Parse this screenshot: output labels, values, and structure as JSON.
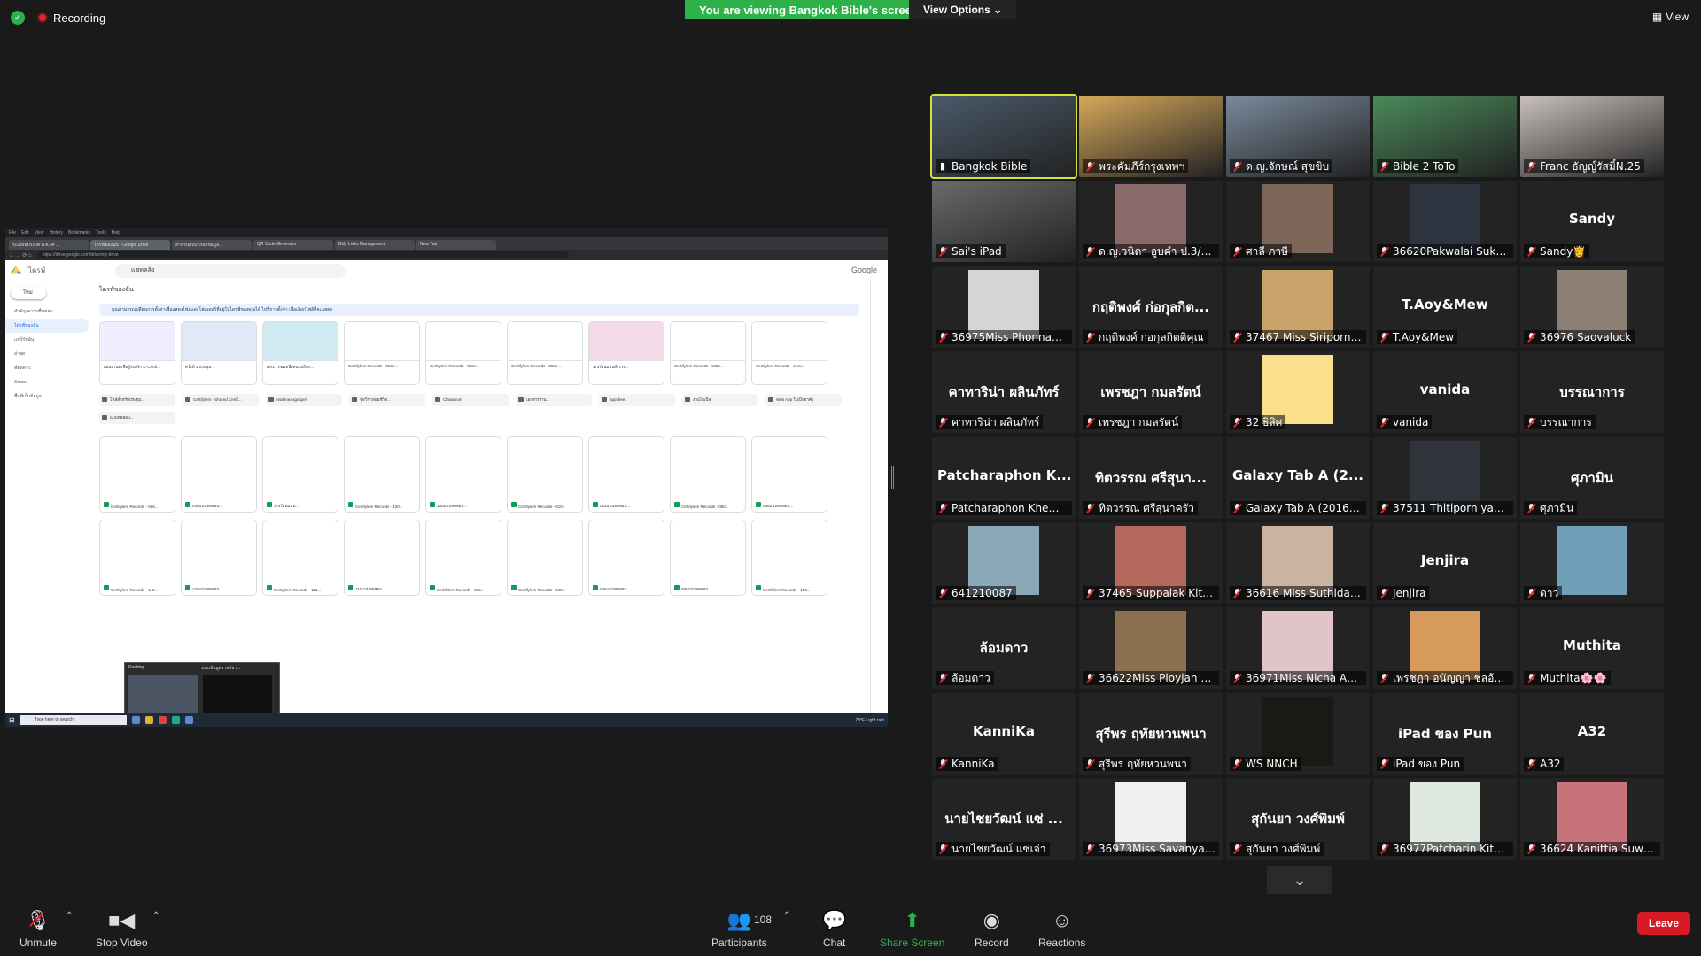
{
  "top": {
    "recording_label": "Recording",
    "share_banner": "You are viewing Bangkok Bible's screen",
    "view_options_label": "View Options ⌄",
    "view_label": "View"
  },
  "shared_screen": {
    "browser_tabs": [
      "ระเบียนประวัติ พ.ค.64 ...",
      "ไดรฟ์ของฉัน - Google Drive",
      "สำหรับแบบกรอกข้อมูล...",
      "QR Code Generator",
      "Bitly Links Management",
      "New Tab"
    ],
    "url": "https://drive.google.com/drive/my-drive",
    "drive_title": "ไดรฟ์",
    "search_value": "แชทคลัง",
    "google_label": "Google",
    "new_button": "ใหม่",
    "nav": [
      "สำคัญ/ความชื่นชอบ",
      "ไดรฟ์ของฉัน",
      "แชร์กับฉัน",
      "ล่าสุด",
      "ที่ติดดาว",
      "ถังขยะ",
      "พื้นที่เก็บข้อมูล"
    ],
    "heading": "ไดรฟ์ของฉัน",
    "info_text": "คุณสามารถเปลี่ยนการตั้งค่าเพื่อแสดงไฟล์และโฟลเดอร์ที่อยู่ในไดรฟ์ของคุณได้ ไปที่การตั้งค่า เพื่อเลือกไฟล์ที่จะแสดง",
    "quick_cards": [
      "แผ่นงานลงชื่อผู้รับบริการ Certif...",
      "ครั้งที่ 1 ประชุม...",
      "NR1 ..ก่อนหนึ่งคนบนโลก...",
      "Certifylem Records - 016e...",
      "Certifylem Records - 065e...",
      "Certifylem Records - 050e...",
      "นักเรียนแบบสำรวจ...",
      "Certifylem Records - 045e...",
      "Certifylem Records - 1ccu..."
    ],
    "folders": [
      "ไฟล์สำหรับประชุม...",
      "Certifylem - Shared Certif...",
      "readmeAsgospel",
      "ชุดวิชาสอนชีวิต...",
      "Classroom",
      "เอกสารงาน...",
      "appsheet",
      "งานไบเบิ้ล",
      "Web App ใบเบิกอาศัย",
      "แบบทดสอบ..."
    ],
    "files_row1": [
      "Certifylem Records - 056...",
      "030แบบทดสอบ...",
      "นักเรียนแบบ...",
      "Certifylem Records - 120...",
      "130แบบทดสอบ...",
      "Certifylem Records - 010...",
      "014แบบทดสอบ...",
      "Certifylem Records - 060...",
      "066แบบทดสอบ..."
    ],
    "files_row2": [
      "Certifylem Records - 110...",
      "120แบบทดสอบ...",
      "Certifylem Records - 116...",
      "110แบบทดสอบ...",
      "Certifylem Records - 065...",
      "Certifylem Records - 040...",
      "046แบบทดสอบ...",
      "006แบบทดสอบ...",
      "Certifylem Records - 100..."
    ],
    "taskbar_search": "Type here to search",
    "taskbar_status": "78°F Light rain",
    "thumb_labels": [
      "Desktop",
      "แบบข้อมูลรายวิชา..."
    ]
  },
  "participants": [
    {
      "name": "Bangkok Bible",
      "display": "",
      "kind": "video",
      "color": "#4a5a6a",
      "active": true,
      "muted": false
    },
    {
      "name": "พระคัมภีร์กรุงเทพฯ",
      "display": "",
      "kind": "video",
      "color": "#d7a85a",
      "muted": true
    },
    {
      "name": "ด.ญ.จักษณ์ สุขขิบ",
      "display": "",
      "kind": "video",
      "color": "#7a8a9c",
      "muted": true
    },
    {
      "name": "Bible 2 ToTo",
      "display": "",
      "kind": "video",
      "color": "#4a8a5a",
      "muted": true
    },
    {
      "name": "Franc ธัญญ์รัสมิ์N.25",
      "display": "",
      "kind": "video",
      "color": "#c9c1bc",
      "muted": true
    },
    {
      "name": "Sai's iPad",
      "display": "",
      "kind": "video",
      "color": "#6a6a6a",
      "muted": true
    },
    {
      "name": "ด.ญ.วนิดา อูบคำ ป.3/1 ...",
      "display": "",
      "kind": "photo",
      "color": "#8a6a68",
      "muted": true
    },
    {
      "name": "ศาลี ภาษี",
      "display": "",
      "kind": "photo",
      "color": "#7c6658",
      "muted": true
    },
    {
      "name": "36620Pakwalai Suksa...",
      "display": "",
      "kind": "photo",
      "color": "#2e3340",
      "muted": true
    },
    {
      "name": "Sandy👸",
      "display": "Sandy",
      "kind": "text",
      "muted": true
    },
    {
      "name": "36975Miss Phonnaph...",
      "display": "",
      "kind": "photo",
      "color": "#d5d5d5",
      "muted": true
    },
    {
      "name": "กฤติพงศ์ ก่อกุลกิตติคุณ",
      "display": "กฤติพงศ์ ก่อกุลกิต...",
      "kind": "text",
      "muted": true
    },
    {
      "name": "37467 Miss Siriporn ...",
      "display": "",
      "kind": "photo",
      "color": "#c9a46a",
      "muted": true
    },
    {
      "name": "T.Aoy&Mew",
      "display": "T.Aoy&Mew",
      "kind": "text",
      "muted": true
    },
    {
      "name": "36976 Saovaluck",
      "display": "",
      "kind": "photo",
      "color": "#8c8075",
      "muted": true
    },
    {
      "name": "คาทาริน่า ผลินภัทร์",
      "display": "คาทาริน่า ผลินภัทร์",
      "kind": "text",
      "muted": true
    },
    {
      "name": "เพรชฎา กมลรัตน์",
      "display": "เพรชฎา กมลรัตน์",
      "kind": "text",
      "muted": true
    },
    {
      "name": "32 ธิสิศ",
      "display": "",
      "kind": "photo",
      "color": "#fbe08c",
      "muted": true
    },
    {
      "name": "vanida",
      "display": "vanida",
      "kind": "text",
      "muted": true
    },
    {
      "name": "บรรณาการ",
      "display": "บรรณาการ",
      "kind": "text",
      "muted": true
    },
    {
      "name": "Patcharaphon Khema...",
      "display": "Patcharaphon K...",
      "kind": "text",
      "muted": true
    },
    {
      "name": "ทิตวรรณ ศรีสุนาครัว",
      "display": "ทิตวรรณ ศรีสุนา...",
      "kind": "text",
      "muted": true
    },
    {
      "name": "Galaxy Tab A (2016) ...",
      "display": "Galaxy Tab A (2...",
      "kind": "text",
      "muted": true
    },
    {
      "name": "37511 Thitiporn yaebi...",
      "display": "",
      "kind": "photo",
      "color": "#2f333a",
      "muted": true
    },
    {
      "name": "ศุภามิน",
      "display": "ศุภามิน",
      "kind": "text",
      "muted": true
    },
    {
      "name": "641210087",
      "display": "",
      "kind": "photo",
      "color": "#8aa7b8",
      "muted": true
    },
    {
      "name": "37465 Suppalak Kitba...",
      "display": "",
      "kind": "photo",
      "color": "#b5695d",
      "muted": true
    },
    {
      "name": "36616 Miss Suthida C...",
      "display": "",
      "kind": "photo",
      "color": "#c9b3a1",
      "muted": true
    },
    {
      "name": "Jenjira",
      "display": "Jenjira",
      "kind": "text",
      "muted": true
    },
    {
      "name": "ดาว",
      "display": "",
      "kind": "photo",
      "color": "#6fa0b8",
      "muted": true
    },
    {
      "name": "ล้อมดาว",
      "display": "ล้อมดาว",
      "kind": "text",
      "muted": true
    },
    {
      "name": "36622Miss Ployjan Sa...",
      "display": "",
      "kind": "photo",
      "color": "#8c7150",
      "muted": true
    },
    {
      "name": "36971Miss Nicha Ana...",
      "display": "",
      "kind": "photo",
      "color": "#e0c4c8",
      "muted": true
    },
    {
      "name": "เพรชฎา อนัญญา ชลอ้นชม",
      "display": "",
      "kind": "photo",
      "color": "#d69a5c",
      "muted": true
    },
    {
      "name": "Muthita🌸🌸",
      "display": "Muthita",
      "kind": "text",
      "muted": true
    },
    {
      "name": "KanniKa",
      "display": "KanniKa",
      "kind": "text",
      "muted": true
    },
    {
      "name": "สุรีพร ฤทัยหวนพนา",
      "display": "สุรีพร ฤทัยหวนพนา",
      "kind": "text",
      "muted": true
    },
    {
      "name": "WS NNCH",
      "display": "",
      "kind": "photo",
      "color": "#1a1a14",
      "muted": true
    },
    {
      "name": "iPad ของ Pun",
      "display": "iPad ของ Pun",
      "kind": "text",
      "muted": true
    },
    {
      "name": "A32",
      "display": "A32",
      "kind": "text",
      "muted": true
    },
    {
      "name": "นายไชยวัฒน์ แซ่เจ่า",
      "display": "นายไชยวัฒน์ แซ่ ...",
      "kind": "text",
      "muted": true
    },
    {
      "name": "36973Miss Savanya P...",
      "display": "",
      "kind": "photo",
      "color": "#f0f0f0",
      "muted": true
    },
    {
      "name": "สุกันยา วงศ์พิมพ์",
      "display": "สุกันยา วงศ์พิมพ์",
      "kind": "text",
      "muted": true
    },
    {
      "name": "36977Patcharin Kitbu...",
      "display": "",
      "kind": "photo",
      "color": "#dfe8df",
      "muted": true
    },
    {
      "name": "36624 Kanittia Suwea...",
      "display": "",
      "kind": "photo",
      "color": "#c8727a",
      "muted": true
    }
  ],
  "toolbar": {
    "unmute": "Unmute",
    "stop_video": "Stop Video",
    "participants": "Participants",
    "participant_count": "108",
    "chat": "Chat",
    "share_screen": "Share Screen",
    "record": "Record",
    "reactions": "Reactions",
    "leave": "Leave"
  }
}
